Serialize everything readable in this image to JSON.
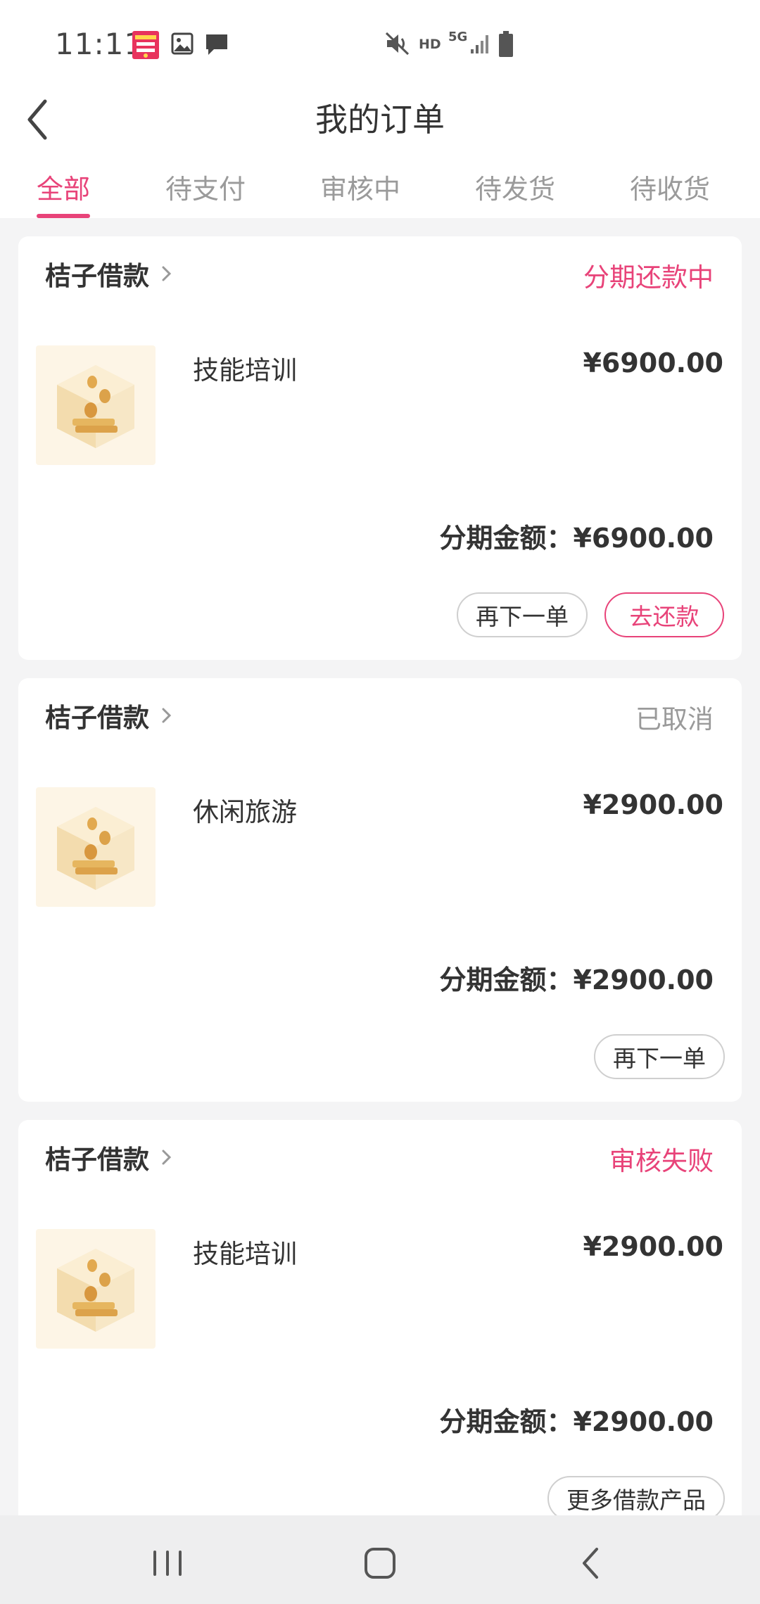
{
  "status_bar": {
    "time": "11:11",
    "icons": [
      "app-notification-icon",
      "image-icon",
      "message-icon",
      "mute-icon",
      "hd-icon",
      "5g-icon",
      "signal-icon",
      "battery-icon"
    ],
    "hd_label": "HD",
    "network_label": "5G"
  },
  "header": {
    "title": "我的订单",
    "back_icon": "back-chevron-icon"
  },
  "tabs": [
    {
      "label": "全部",
      "active": true
    },
    {
      "label": "待支付",
      "active": false
    },
    {
      "label": "审核中",
      "active": false
    },
    {
      "label": "待发货",
      "active": false
    },
    {
      "label": "待收货",
      "active": false
    }
  ],
  "colors": {
    "accent": "#e84379",
    "muted_status": "#9a9a9a",
    "text": "#333333",
    "background": "#f4f4f5"
  },
  "orders": [
    {
      "provider": "桔子借款",
      "status": "分期还款中",
      "status_color": "#e84379",
      "product_name": "技能培训",
      "price": "¥6900.00",
      "installment": "分期金额：¥6900.00",
      "buttons": [
        {
          "label": "再下一单",
          "style": "default"
        },
        {
          "label": "去还款",
          "style": "pink"
        }
      ]
    },
    {
      "provider": "桔子借款",
      "status": "已取消",
      "status_color": "#9a9a9a",
      "product_name": "休闲旅游",
      "price": "¥2900.00",
      "installment": "分期金额：¥2900.00",
      "buttons": [
        {
          "label": "再下一单",
          "style": "default"
        }
      ]
    },
    {
      "provider": "桔子借款",
      "status": "审核失败",
      "status_color": "#e84379",
      "product_name": "技能培训",
      "price": "¥2900.00",
      "installment": "分期金额：¥2900.00",
      "buttons": [
        {
          "label": "更多借款产品",
          "style": "default"
        }
      ]
    }
  ],
  "nav_bar": {
    "items": [
      "recent-apps-icon",
      "home-icon",
      "back-icon"
    ]
  }
}
